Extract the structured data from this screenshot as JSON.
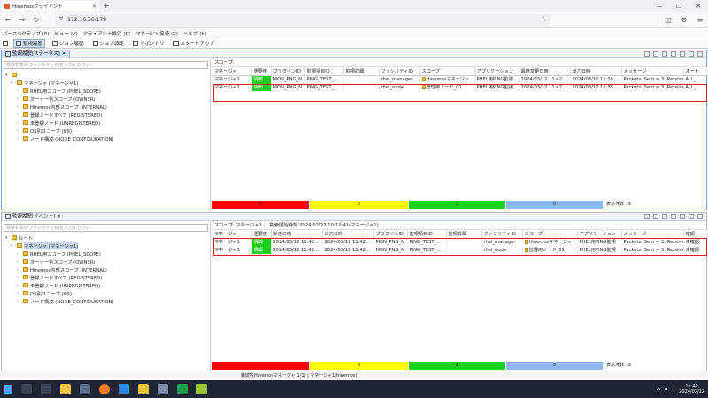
{
  "browser": {
    "tab_title": "Hinemosクライアント",
    "url": "172.16.56.179"
  },
  "menu": [
    "パースペクティブ (P)",
    "ビュー (V)",
    "クライアント設定 (S)",
    "マネージャ接続 (C)",
    "ヘルプ (H)"
  ],
  "toolbar": [
    "監視履歴",
    "ジョブ履歴",
    "ジョブ設定",
    "リポジトリ",
    "スタートアップ"
  ],
  "status_pane": {
    "tab_label": "監視履歴[ステータス]",
    "filter_placeholder": "検索対象のファシリティIDを入力ください...",
    "scope_label": "スコープ:",
    "tree": [
      {
        "label": "",
        "level": 0,
        "selected": true
      },
      {
        "label": "マネージャ (マネージャ1)",
        "level": 1
      },
      {
        "label": "RHEL用スコープ (PHEL_SCOPE)",
        "level": 2
      },
      {
        "label": "オーナー別スコープ (OWNER)",
        "level": 2
      },
      {
        "label": "Hinemos内部スコープ (INTERNAL)",
        "level": 2
      },
      {
        "label": "登録ノードすべて (REGISTERED)",
        "level": 2
      },
      {
        "label": "未登録ノード (UNREGISTERED)",
        "level": 2
      },
      {
        "label": "OS別スコープ (OS)",
        "level": 2
      },
      {
        "label": "ノード構成 (NODE_CONFIGURATION)",
        "level": 2
      }
    ],
    "columns": [
      "マネージャ",
      "重要度",
      "プラグインID",
      "監視項目ID",
      "監視詳細",
      "ファシリティID",
      "スコープ",
      "アプリケーション",
      "最終変更日時",
      "出力日時",
      "メッセージ",
      "オーナ"
    ],
    "rows": [
      [
        "マネージャ1",
        "情報",
        "MON_PNG_N",
        "PING_TEST_...",
        "",
        "rhel_manager",
        "Hinemosマネージャ",
        "PHEL用PING監視",
        "2024/03/12 11:42...",
        "2024/03/12 11:35...",
        "Packets: Sent = 3, Received ...",
        "ALL_"
      ],
      [
        "マネージャ1",
        "情報",
        "MON_PNG_N",
        "PING_TEST_...",
        "",
        "rhel_node",
        "管理用ノード_01",
        "PHEL用PING監視",
        "2024/03/12 11:42...",
        "2024/03/12 11:35...",
        "Packets: Sent = 3, Received ...",
        "ALL_"
      ]
    ],
    "summary": {
      "critical": "0",
      "warning": "0",
      "info": "2",
      "unknown": "0",
      "count_label": "表示件数 : 2"
    }
  },
  "event_pane": {
    "tab_label": "監視履歴[イベント]",
    "filter_placeholder": "検索対象のファシリティIDを入力ください...",
    "scope_label": "スコープ: マネージャ1 、 検索開始時刻:2024/02/23 10:12:41(マネージャ1)",
    "tree": [
      {
        "label": "ルート",
        "level": 0
      },
      {
        "label": "マネージャ (マネージャ1)",
        "level": 1,
        "selected": true
      },
      {
        "label": "RHEL用スコープ (PHEL_SCOPE)",
        "level": 2
      },
      {
        "label": "オーナー別スコープ (OWNER)",
        "level": 2
      },
      {
        "label": "Hinemos内部スコープ (INTERNAL)",
        "level": 2
      },
      {
        "label": "登録ノードすべて (REGISTERED)",
        "level": 2
      },
      {
        "label": "未登録ノード (UNREGISTERED)",
        "level": 2
      },
      {
        "label": "OS別スコープ (OS)",
        "level": 2
      },
      {
        "label": "ノード構成 (NODE_CONFIGURATION)",
        "level": 2
      }
    ],
    "columns": [
      "マネージャ",
      "重要度",
      "受信日時",
      "出力日時",
      "プラグインID",
      "監視項目ID",
      "監視詳細",
      "ファシリティID",
      "スコープ",
      "アプリケーション",
      "メッセージ",
      "確認"
    ],
    "rows": [
      [
        "マネージャ1",
        "情報",
        "2024/03/12 11:42...",
        "2024/03/12 11:42...",
        "MON_PNG_N",
        "PING_TEST_...",
        "",
        "rhel_manager",
        "Hinemosマネージャ",
        "PHEL用PING監視",
        "Packets: Sent = 3, Received ...",
        "未確認"
      ],
      [
        "マネージャ1",
        "情報",
        "2024/03/12 11:42...",
        "2024/03/12 11:42...",
        "MON_PNG_N",
        "PING_TEST_...",
        "",
        "rhel_node",
        "管理用ノード_01",
        "PHEL用PING監視",
        "Packets: Sent = 3, Received ...",
        "未確認"
      ]
    ],
    "summary": {
      "critical": "",
      "warning": "0",
      "info": "2",
      "unknown": "0",
      "count_label": "表示件数 : 2"
    }
  },
  "app_status": "接続先Hinemosマネージャ(1/1) | マネージャ1(hinemos)",
  "taskbar": {
    "time": "11:42",
    "date": "2024/03/12"
  },
  "colors": {
    "critical": "#ff0000",
    "warning": "#ffff00",
    "info": "#19d219",
    "unknown": "#8fb8f0"
  }
}
